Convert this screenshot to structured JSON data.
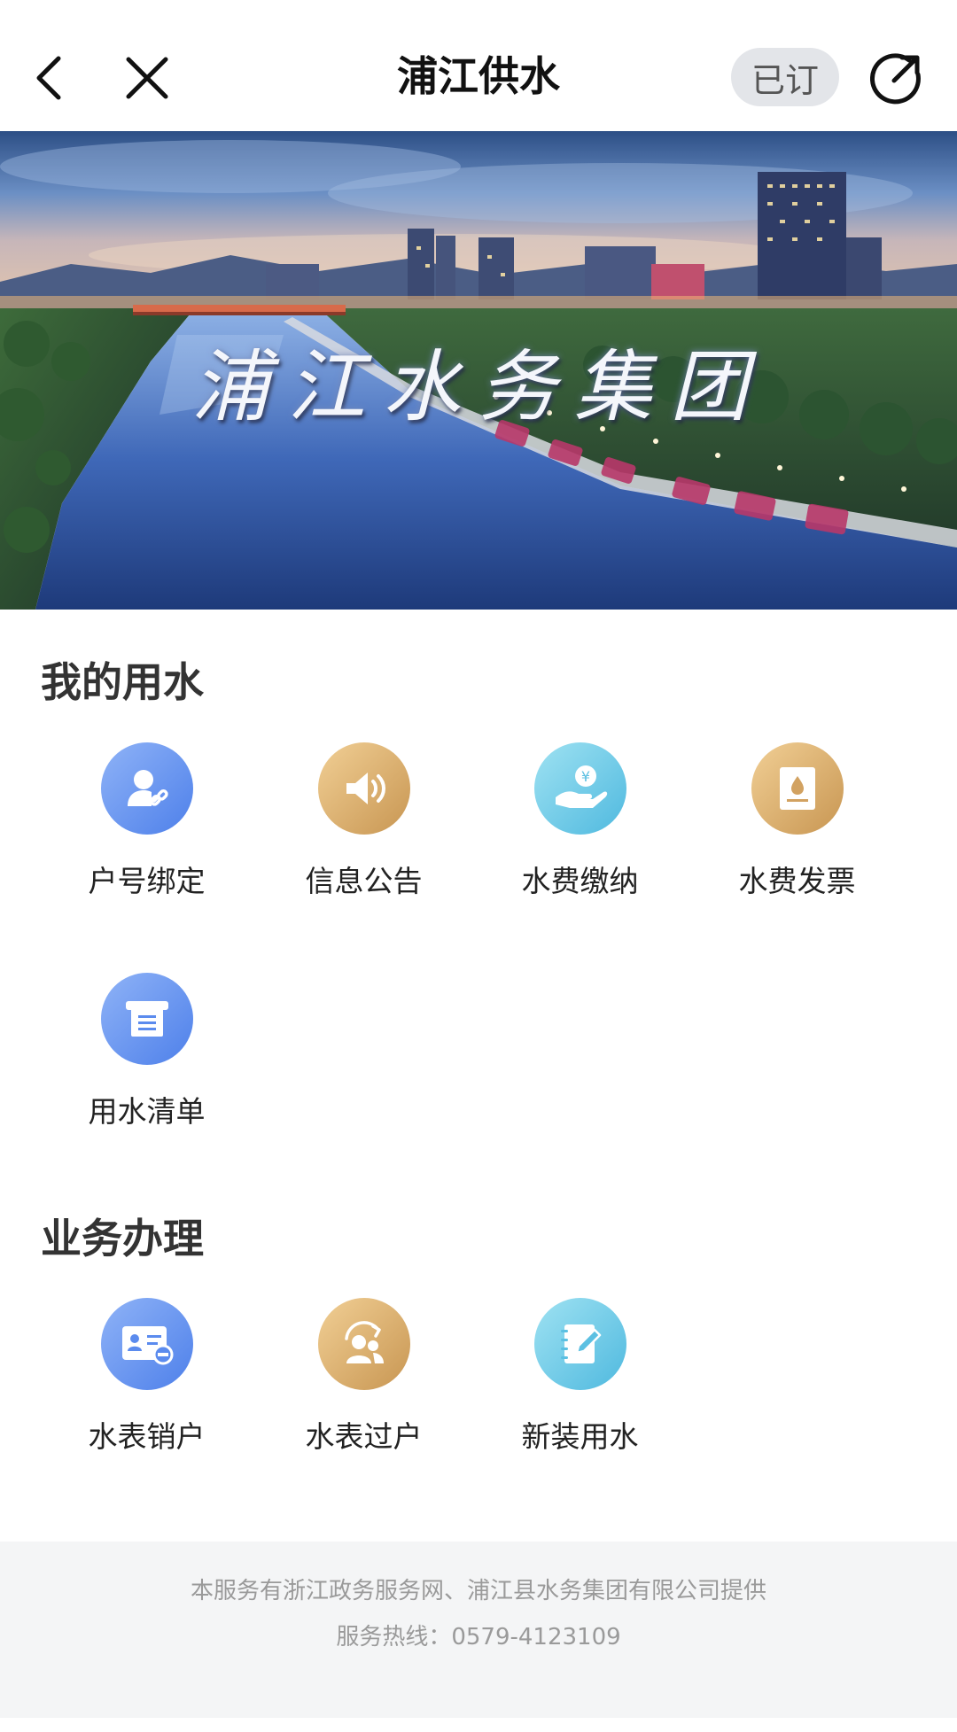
{
  "header": {
    "title": "浦江供水",
    "subscribed_label": "已订",
    "back_icon": "chevron-left-icon",
    "close_icon": "close-icon",
    "share_icon": "share-arrow-icon"
  },
  "banner": {
    "caption": "浦江水务集团"
  },
  "my_water": {
    "title": "我的用水",
    "items": [
      {
        "label": "户号绑定",
        "icon": "account-link-icon",
        "color": "#5b8bee"
      },
      {
        "label": "信息公告",
        "icon": "megaphone-icon",
        "color": "#d2a261"
      },
      {
        "label": "水费缴纳",
        "icon": "payment-hand-icon",
        "color": "#5cc0e2"
      },
      {
        "label": "水费发票",
        "icon": "invoice-icon",
        "color": "#d2a261"
      },
      {
        "label": "用水清单",
        "icon": "bill-list-icon",
        "color": "#5b8bee"
      }
    ]
  },
  "business": {
    "title": "业务办理",
    "items": [
      {
        "label": "水表销户",
        "icon": "meter-cancel-icon",
        "color": "#5b8bee"
      },
      {
        "label": "水表过户",
        "icon": "transfer-user-icon",
        "color": "#d2a261"
      },
      {
        "label": "新装用水",
        "icon": "new-install-icon",
        "color": "#5cc0e2"
      }
    ]
  },
  "footer": {
    "provider": "本服务有浙江政务服务网、浦江县水务集团有限公司提供",
    "hotline": "服务热线：0579-4123109"
  }
}
